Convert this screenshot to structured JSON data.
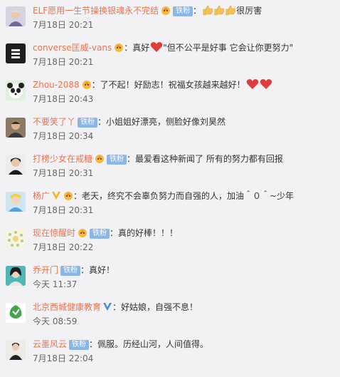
{
  "comments": [
    {
      "user": "ELF愿用一生节操换银魂永不完结",
      "badge": "铁粉",
      "text": "很厉害",
      "emojis": "thumbs-up x3",
      "time": "7月18日 20:21"
    },
    {
      "user": "converse匡威-vans",
      "text": "：真好",
      "text2": "\"但不公平是好事 它会让你更努力\"",
      "emojis": "heart",
      "time": "7月18日 20:21"
    },
    {
      "user": "Zhou-2088",
      "text": "：了不起！好励志！祝福女孩越来越好！",
      "emojis": "heart x2",
      "time": "7月18日 20:43"
    },
    {
      "user": "不要笑了丫",
      "badge": "铁粉",
      "text": "：小姐姐好漂亮，侧脸好像刘昊然",
      "time": "7月18日 20:34"
    },
    {
      "user": "打榜少女在戒糖",
      "badge": "铁粉",
      "text": "：最爱看这种新闻了 所有的努力都有回报",
      "time": "7月18日 20:31"
    },
    {
      "user": "杨广",
      "text": "：老天，终究不会辜负努力而自强的人，加油＾０＾~少年",
      "time": "7月18日 20:31"
    },
    {
      "user": "现在惊醒时",
      "badge": "铁粉",
      "text": "：真的好棒！！！",
      "time": "7月18日 20:22"
    },
    {
      "user": "乔开门",
      "badge": "铁粉",
      "text": "：真好！",
      "time": "今天 11:37"
    },
    {
      "user": "北京西城健康教育",
      "text": "：好姑娘，自强不息！",
      "time": "今天 08:59"
    },
    {
      "user": "云墨风云",
      "badge": "铁粉",
      "text": "：佩服。历经山河，人间值得。",
      "time": "7月18日 22:04"
    }
  ],
  "colors": {
    "username": "#eb7350",
    "background": "#f2f2f5",
    "fan_badge": "#8bb6e6"
  }
}
